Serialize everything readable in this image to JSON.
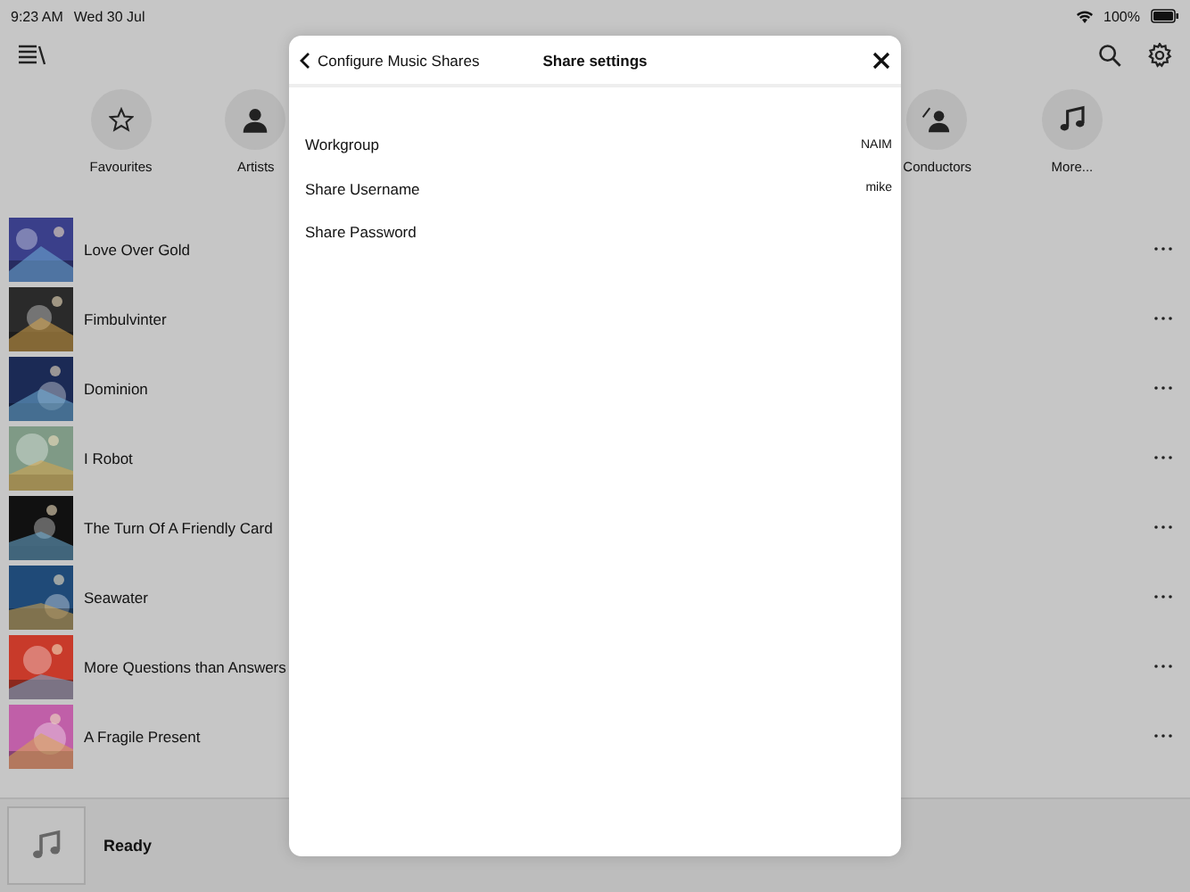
{
  "status_bar": {
    "time": "9:23 AM",
    "date": "Wed 30 Jul",
    "battery": "100%"
  },
  "categories": [
    {
      "label": "Favourites",
      "kind": "star"
    },
    {
      "label": "Artists",
      "kind": "person"
    },
    {
      "label": "Conductors",
      "kind": "conductor"
    },
    {
      "label": "More...",
      "kind": "note"
    }
  ],
  "albums": [
    {
      "title": "Love Over Gold",
      "color": "#3a3f8a"
    },
    {
      "title": "Fimbulvinter",
      "color": "#2a2a2a"
    },
    {
      "title": "Dominion",
      "color": "#1b2a55"
    },
    {
      "title": "I Robot",
      "color": "#7f9a86"
    },
    {
      "title": "The Turn Of A Friendly Card",
      "color": "#111111"
    },
    {
      "title": "Seawater",
      "color": "#1f4a78"
    },
    {
      "title": "More Questions than Answers",
      "color": "#c83a2a"
    },
    {
      "title": "A Fragile Present",
      "color": "#c05fa8"
    }
  ],
  "now_playing": {
    "status": "Ready"
  },
  "dialog": {
    "back_label": "Configure Music Shares",
    "title": "Share settings",
    "rows": [
      {
        "label": "Workgroup",
        "value": "NAIM"
      },
      {
        "label": "Share Username",
        "value": "mike"
      },
      {
        "label": "Share Password"
      }
    ]
  }
}
